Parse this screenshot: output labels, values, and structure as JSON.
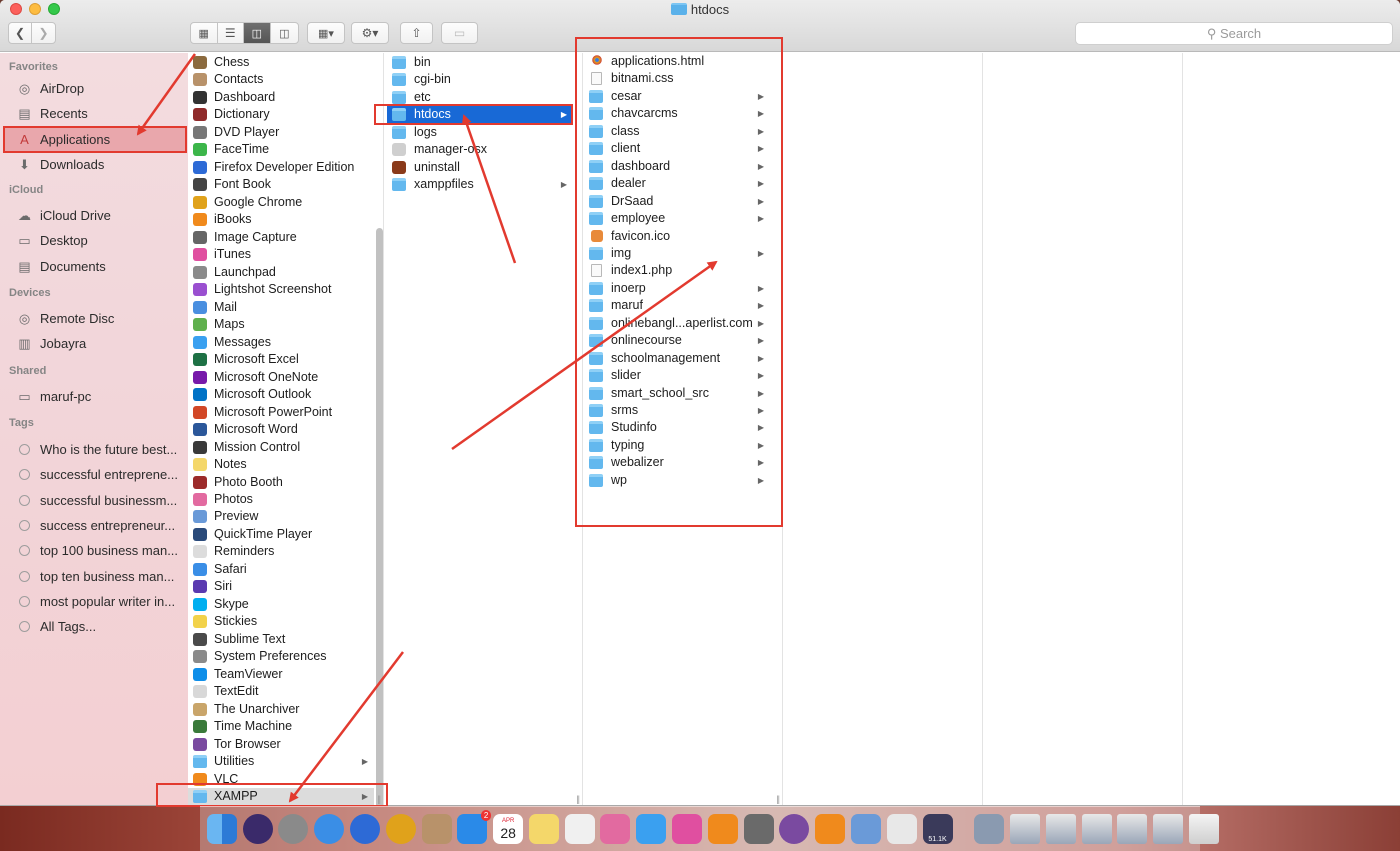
{
  "window": {
    "title": "htdocs"
  },
  "toolbar": {
    "search_placeholder": "Search"
  },
  "sidebar": {
    "sections": [
      {
        "title": "Favorites",
        "items": [
          {
            "label": "AirDrop",
            "icon": "airdrop-icon"
          },
          {
            "label": "Recents",
            "icon": "clock-icon"
          },
          {
            "label": "Applications",
            "icon": "applications-icon",
            "selected": true
          },
          {
            "label": "Downloads",
            "icon": "download-icon"
          }
        ]
      },
      {
        "title": "iCloud",
        "items": [
          {
            "label": "iCloud Drive",
            "icon": "cloud-icon"
          },
          {
            "label": "Desktop",
            "icon": "desktop-icon"
          },
          {
            "label": "Documents",
            "icon": "document-icon"
          }
        ]
      },
      {
        "title": "Devices",
        "items": [
          {
            "label": "Remote Disc",
            "icon": "disc-icon"
          },
          {
            "label": "Jobayra",
            "icon": "drive-icon"
          }
        ]
      },
      {
        "title": "Shared",
        "items": [
          {
            "label": "maruf-pc",
            "icon": "computer-icon"
          }
        ]
      },
      {
        "title": "Tags",
        "items": [
          {
            "label": "Who is the future best..."
          },
          {
            "label": "successful entreprene..."
          },
          {
            "label": "successful businessm..."
          },
          {
            "label": "success entrepreneur..."
          },
          {
            "label": "top 100 business man..."
          },
          {
            "label": "top ten business man..."
          },
          {
            "label": "most popular writer in..."
          },
          {
            "label": "All Tags..."
          }
        ]
      }
    ]
  },
  "column1": {
    "items": [
      {
        "label": "Chess",
        "color": "#8b6a3e"
      },
      {
        "label": "Contacts",
        "color": "#b8926a"
      },
      {
        "label": "Dashboard",
        "color": "#333333"
      },
      {
        "label": "Dictionary",
        "color": "#8f2a2a"
      },
      {
        "label": "DVD Player",
        "color": "#777777"
      },
      {
        "label": "FaceTime",
        "color": "#3cb64a"
      },
      {
        "label": "Firefox Developer Edition",
        "color": "#2d6ad6"
      },
      {
        "label": "Font Book",
        "color": "#444444"
      },
      {
        "label": "Google Chrome",
        "color": "#e0a21b"
      },
      {
        "label": "iBooks",
        "color": "#f08a1c"
      },
      {
        "label": "Image Capture",
        "color": "#666666"
      },
      {
        "label": "iTunes",
        "color": "#e04fa0"
      },
      {
        "label": "Launchpad",
        "color": "#8a8a8a"
      },
      {
        "label": "Lightshot Screenshot",
        "color": "#9a4fd0"
      },
      {
        "label": "Mail",
        "color": "#4a8fe0"
      },
      {
        "label": "Maps",
        "color": "#5fb04d"
      },
      {
        "label": "Messages",
        "color": "#3aa0f0"
      },
      {
        "label": "Microsoft Excel",
        "color": "#1e7145"
      },
      {
        "label": "Microsoft OneNote",
        "color": "#7719aa"
      },
      {
        "label": "Microsoft Outlook",
        "color": "#0072c6"
      },
      {
        "label": "Microsoft PowerPoint",
        "color": "#d24726"
      },
      {
        "label": "Microsoft Word",
        "color": "#2b579a"
      },
      {
        "label": "Mission Control",
        "color": "#3a3a3a"
      },
      {
        "label": "Notes",
        "color": "#f4d76a"
      },
      {
        "label": "Photo Booth",
        "color": "#9c2a2a"
      },
      {
        "label": "Photos",
        "color": "#e26aa0"
      },
      {
        "label": "Preview",
        "color": "#6a9ad8"
      },
      {
        "label": "QuickTime Player",
        "color": "#2a4a7a"
      },
      {
        "label": "Reminders",
        "color": "#dcdcdc"
      },
      {
        "label": "Safari",
        "color": "#3a8ee6"
      },
      {
        "label": "Siri",
        "color": "#5a3ab0"
      },
      {
        "label": "Skype",
        "color": "#00aff0"
      },
      {
        "label": "Stickies",
        "color": "#f2d24a"
      },
      {
        "label": "Sublime Text",
        "color": "#4a4a4a"
      },
      {
        "label": "System Preferences",
        "color": "#8a8a8a"
      },
      {
        "label": "TeamViewer",
        "color": "#0e8ee9"
      },
      {
        "label": "TextEdit",
        "color": "#d8d8d8"
      },
      {
        "label": "The Unarchiver",
        "color": "#c9a56a"
      },
      {
        "label": "Time Machine",
        "color": "#3a7a3a"
      },
      {
        "label": "Tor Browser",
        "color": "#7a4aa0"
      },
      {
        "label": "Utilities",
        "color": "#63b8ee",
        "folder": true,
        "arrow": true
      },
      {
        "label": "VLC",
        "color": "#f08a1c"
      },
      {
        "label": "XAMPP",
        "color": "#63b8ee",
        "folder": true,
        "arrow": true,
        "highlight": true
      }
    ]
  },
  "column2": {
    "items": [
      {
        "label": "bin",
        "kind": "folder"
      },
      {
        "label": "cgi-bin",
        "kind": "folder"
      },
      {
        "label": "etc",
        "kind": "folder"
      },
      {
        "label": "htdocs",
        "kind": "folder",
        "selected": true,
        "arrow": true
      },
      {
        "label": "logs",
        "kind": "folder"
      },
      {
        "label": "manager-osx",
        "kind": "app"
      },
      {
        "label": "uninstall",
        "kind": "app"
      },
      {
        "label": "xamppfiles",
        "kind": "folder",
        "arrow": true
      }
    ]
  },
  "column3": {
    "items": [
      {
        "label": "applications.html",
        "kind": "html"
      },
      {
        "label": "bitnami.css",
        "kind": "doc"
      },
      {
        "label": "cesar",
        "kind": "folder",
        "arrow": true
      },
      {
        "label": "chavcarcms",
        "kind": "folder",
        "arrow": true
      },
      {
        "label": "class",
        "kind": "folder",
        "arrow": true
      },
      {
        "label": "client",
        "kind": "folder",
        "arrow": true
      },
      {
        "label": "dashboard",
        "kind": "folder",
        "arrow": true
      },
      {
        "label": "dealer",
        "kind": "folder",
        "arrow": true
      },
      {
        "label": "DrSaad",
        "kind": "folder",
        "arrow": true
      },
      {
        "label": "employee",
        "kind": "folder",
        "arrow": true
      },
      {
        "label": "favicon.ico",
        "kind": "ico"
      },
      {
        "label": "img",
        "kind": "folder",
        "arrow": true
      },
      {
        "label": "index1.php",
        "kind": "doc"
      },
      {
        "label": "inoerp",
        "kind": "folder",
        "arrow": true
      },
      {
        "label": "maruf",
        "kind": "folder",
        "arrow": true
      },
      {
        "label": "onlinebangl...aperlist.com",
        "kind": "folder",
        "arrow": true
      },
      {
        "label": "onlinecourse",
        "kind": "folder",
        "arrow": true
      },
      {
        "label": "schoolmanagement",
        "kind": "folder",
        "arrow": true
      },
      {
        "label": "slider",
        "kind": "folder",
        "arrow": true
      },
      {
        "label": "smart_school_src",
        "kind": "folder",
        "arrow": true
      },
      {
        "label": "srms",
        "kind": "folder",
        "arrow": true
      },
      {
        "label": "Studinfo",
        "kind": "folder",
        "arrow": true
      },
      {
        "label": "typing",
        "kind": "folder",
        "arrow": true
      },
      {
        "label": "webalizer",
        "kind": "folder",
        "arrow": true
      },
      {
        "label": "wp",
        "kind": "folder",
        "arrow": true
      }
    ]
  },
  "dock": {
    "calendar_month": "APR",
    "calendar_day": "28",
    "appstore_badge": "2",
    "netspeed": "51.1K",
    "apps": [
      {
        "name": "finder-icon",
        "color": "#4a9be8"
      },
      {
        "name": "siri-icon",
        "color": "#3a2a6a"
      },
      {
        "name": "launchpad-icon",
        "color": "#8a8a8a"
      },
      {
        "name": "safari-icon",
        "color": "#3a8ee6"
      },
      {
        "name": "firefox-icon",
        "color": "#2d6ad6"
      },
      {
        "name": "chrome-icon",
        "color": "#e0a21b"
      },
      {
        "name": "contacts-icon",
        "color": "#b8926a"
      },
      {
        "name": "appstore-icon",
        "color": "#2a8ae8"
      },
      {
        "name": "calendar-icon",
        "color": "#ffffff"
      },
      {
        "name": "notes-icon",
        "color": "#f4d76a"
      },
      {
        "name": "reminders-icon",
        "color": "#f0f0f0"
      },
      {
        "name": "photos-icon",
        "color": "#e26aa0"
      },
      {
        "name": "messages-icon",
        "color": "#3aa0f0"
      },
      {
        "name": "itunes-icon",
        "color": "#e04fa0"
      },
      {
        "name": "ibooks-icon",
        "color": "#f08a1c"
      },
      {
        "name": "system-preferences-icon",
        "color": "#6a6a6a"
      },
      {
        "name": "tor-browser-icon",
        "color": "#7a4aa0"
      },
      {
        "name": "vlc-icon",
        "color": "#f08a1c"
      },
      {
        "name": "preview-icon",
        "color": "#6a9ad8"
      },
      {
        "name": "textedit-icon",
        "color": "#e8e8e8"
      },
      {
        "name": "network-monitor-icon",
        "color": "#3a3a5a"
      },
      {
        "name": "utility-icon",
        "color": "#8a9ab0"
      }
    ]
  }
}
